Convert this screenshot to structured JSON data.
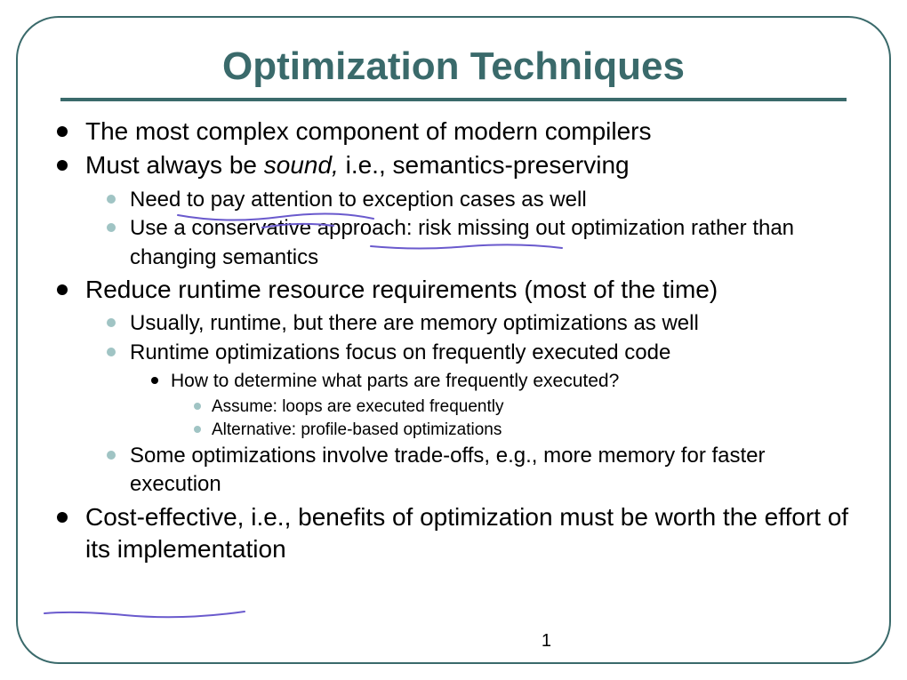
{
  "title": "Optimization Techniques",
  "page_number": "1",
  "bullets": [
    {
      "text": "The most complex component of modern compilers"
    },
    {
      "parts": [
        {
          "t": "Must always be "
        },
        {
          "t": "sound,",
          "italic": true
        },
        {
          "t": " i.e., semantics-preserving"
        }
      ],
      "children": [
        {
          "text": "Need to pay attention to exception cases as well"
        },
        {
          "text": "Use a conservative approach: risk missing out optimization rather than changing semantics"
        }
      ]
    },
    {
      "text": "Reduce runtime resource requirements (most of the time)",
      "children": [
        {
          "text": "Usually, runtime, but there are memory optimizations as well"
        },
        {
          "text": "Runtime optimizations focus on frequently executed code",
          "children": [
            {
              "text": "How to determine what parts are frequently executed?",
              "children": [
                {
                  "text": "Assume: loops are executed frequently"
                },
                {
                  "text": "Alternative: profile-based optimizations"
                }
              ]
            }
          ]
        },
        {
          "text": "Some optimizations involve trade-offs, e.g., more memory for faster execution"
        }
      ]
    },
    {
      "text": "Cost-effective, i.e., benefits of optimization must be worth the effort of its implementation"
    }
  ]
}
